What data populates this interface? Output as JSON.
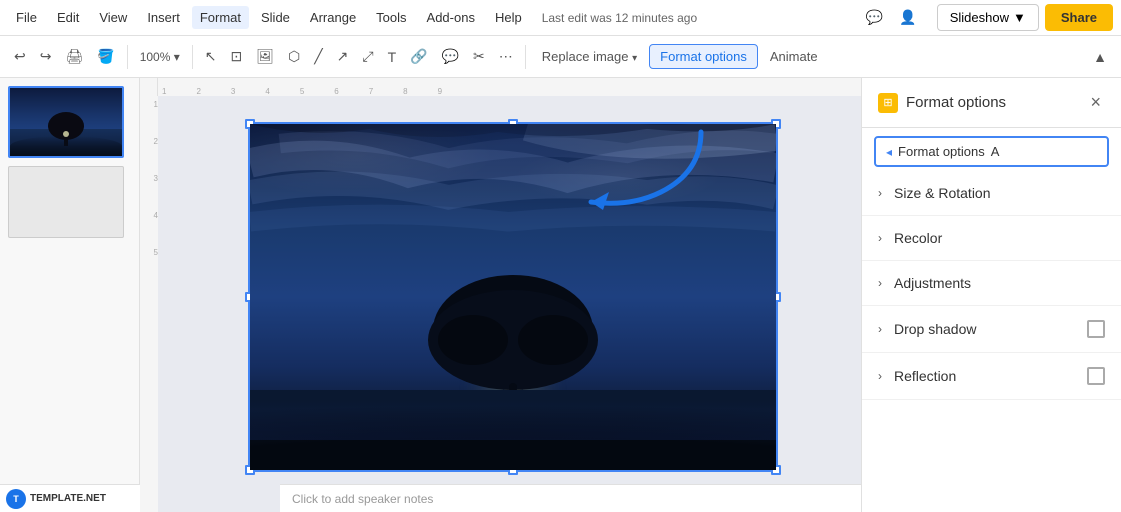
{
  "menu": {
    "items": [
      "File",
      "Edit",
      "View",
      "Insert",
      "Format",
      "Slide",
      "Arrange",
      "Tools",
      "Add-ons",
      "Help"
    ],
    "last_edit": "Last edit was 12 minutes ago",
    "format_index": 4
  },
  "toolbar": {
    "undo_label": "↩",
    "redo_label": "↪",
    "print_label": "🖨",
    "paint_label": "🪣",
    "zoom_label": "100%",
    "select_label": "↖",
    "replace_image_label": "Replace image",
    "format_options_label": "Format options",
    "animate_label": "Animate",
    "collapse_label": "▲"
  },
  "format_panel": {
    "title": "Format options",
    "icon_label": "F",
    "close_label": "×",
    "badge_text": "Format options",
    "badge_letter": "A",
    "sections": [
      {
        "label": "Size & Rotation",
        "has_checkbox": false
      },
      {
        "label": "Recolor",
        "has_checkbox": false
      },
      {
        "label": "Adjustments",
        "has_checkbox": false
      },
      {
        "label": "Drop shadow",
        "has_checkbox": true
      },
      {
        "label": "Reflection",
        "has_checkbox": true
      }
    ]
  },
  "slides": [
    {
      "id": 1,
      "active": true
    },
    {
      "id": 2,
      "active": false
    }
  ],
  "notes": {
    "placeholder": "Click to add speaker notes"
  },
  "template": {
    "logo_text": "T",
    "name": "TEMPLATE.NET"
  },
  "colors": {
    "accent_blue": "#4285f4",
    "accent_yellow": "#fbbc04",
    "panel_bg": "#ffffff",
    "canvas_bg": "#e8eaf0"
  }
}
